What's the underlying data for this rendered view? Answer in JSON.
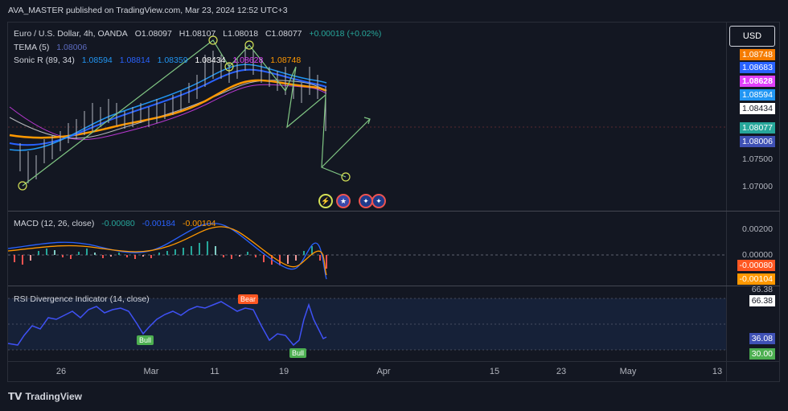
{
  "header": {
    "published": "AVA_MASTER published on TradingView.com, Mar 23, 2024 12:52 UTC+3"
  },
  "main_legend": {
    "symbol": "Euro / U.S. Dollar, 4h, OANDA",
    "o": "O1.08097",
    "h": "H1.08107",
    "l": "L1.08018",
    "c": "C1.08077",
    "chg": "+0.00018 (+0.02%)",
    "tema_label": "TEMA (5)",
    "tema_value": "1.08006",
    "sonic_label": "Sonic R (89, 34)",
    "sonic_values": [
      "1.08594",
      "1.08814",
      "1.08359",
      "1.08434",
      "1.08628",
      "1.08748"
    ]
  },
  "currency_button": "USD",
  "price_axis": [
    {
      "text": "1.08748",
      "bg": "#f57c00"
    },
    {
      "text": "1.08683",
      "bg": "#2962ff"
    },
    {
      "text": "1.08628",
      "bg": "#e040fb"
    },
    {
      "text": "1.08594",
      "bg": "#2196f3"
    },
    {
      "text": "1.08434",
      "bg": "#ffffff"
    },
    {
      "text": "1.08077",
      "bg": "#26a69a"
    },
    {
      "text": "1.08006",
      "bg": "#3f51b5"
    },
    {
      "text": "1.07500",
      "bg": ""
    },
    {
      "text": "1.07000",
      "bg": ""
    }
  ],
  "macd_legend": {
    "label": "MACD (12, 26, close)",
    "values": [
      "-0.00080",
      "-0.00184",
      "-0.00104"
    ]
  },
  "macd_axis": [
    {
      "text": "0.00200",
      "bg": ""
    },
    {
      "text": "0.00000",
      "bg": ""
    },
    {
      "text": "-0.00080",
      "bg": "#ff5722"
    },
    {
      "text": "-0.00104",
      "bg": "#ff9800"
    }
  ],
  "rsi_legend": {
    "label": "RSI Divergence Indicator (14, close)"
  },
  "rsi_axis": [
    {
      "text": "66.38",
      "bg": ""
    },
    {
      "text": "66.38",
      "bg": "#ffffff"
    },
    {
      "text": "36.08",
      "bg": "#3f51b5"
    },
    {
      "text": "30.00",
      "bg": "#4caf50"
    }
  ],
  "rsi_badges": [
    "Bull",
    "Bull",
    "Bear"
  ],
  "x_axis": [
    "26",
    "Mar",
    "11",
    "19",
    "Apr",
    "15",
    "23",
    "May",
    "13"
  ],
  "logo": "TradingView"
}
